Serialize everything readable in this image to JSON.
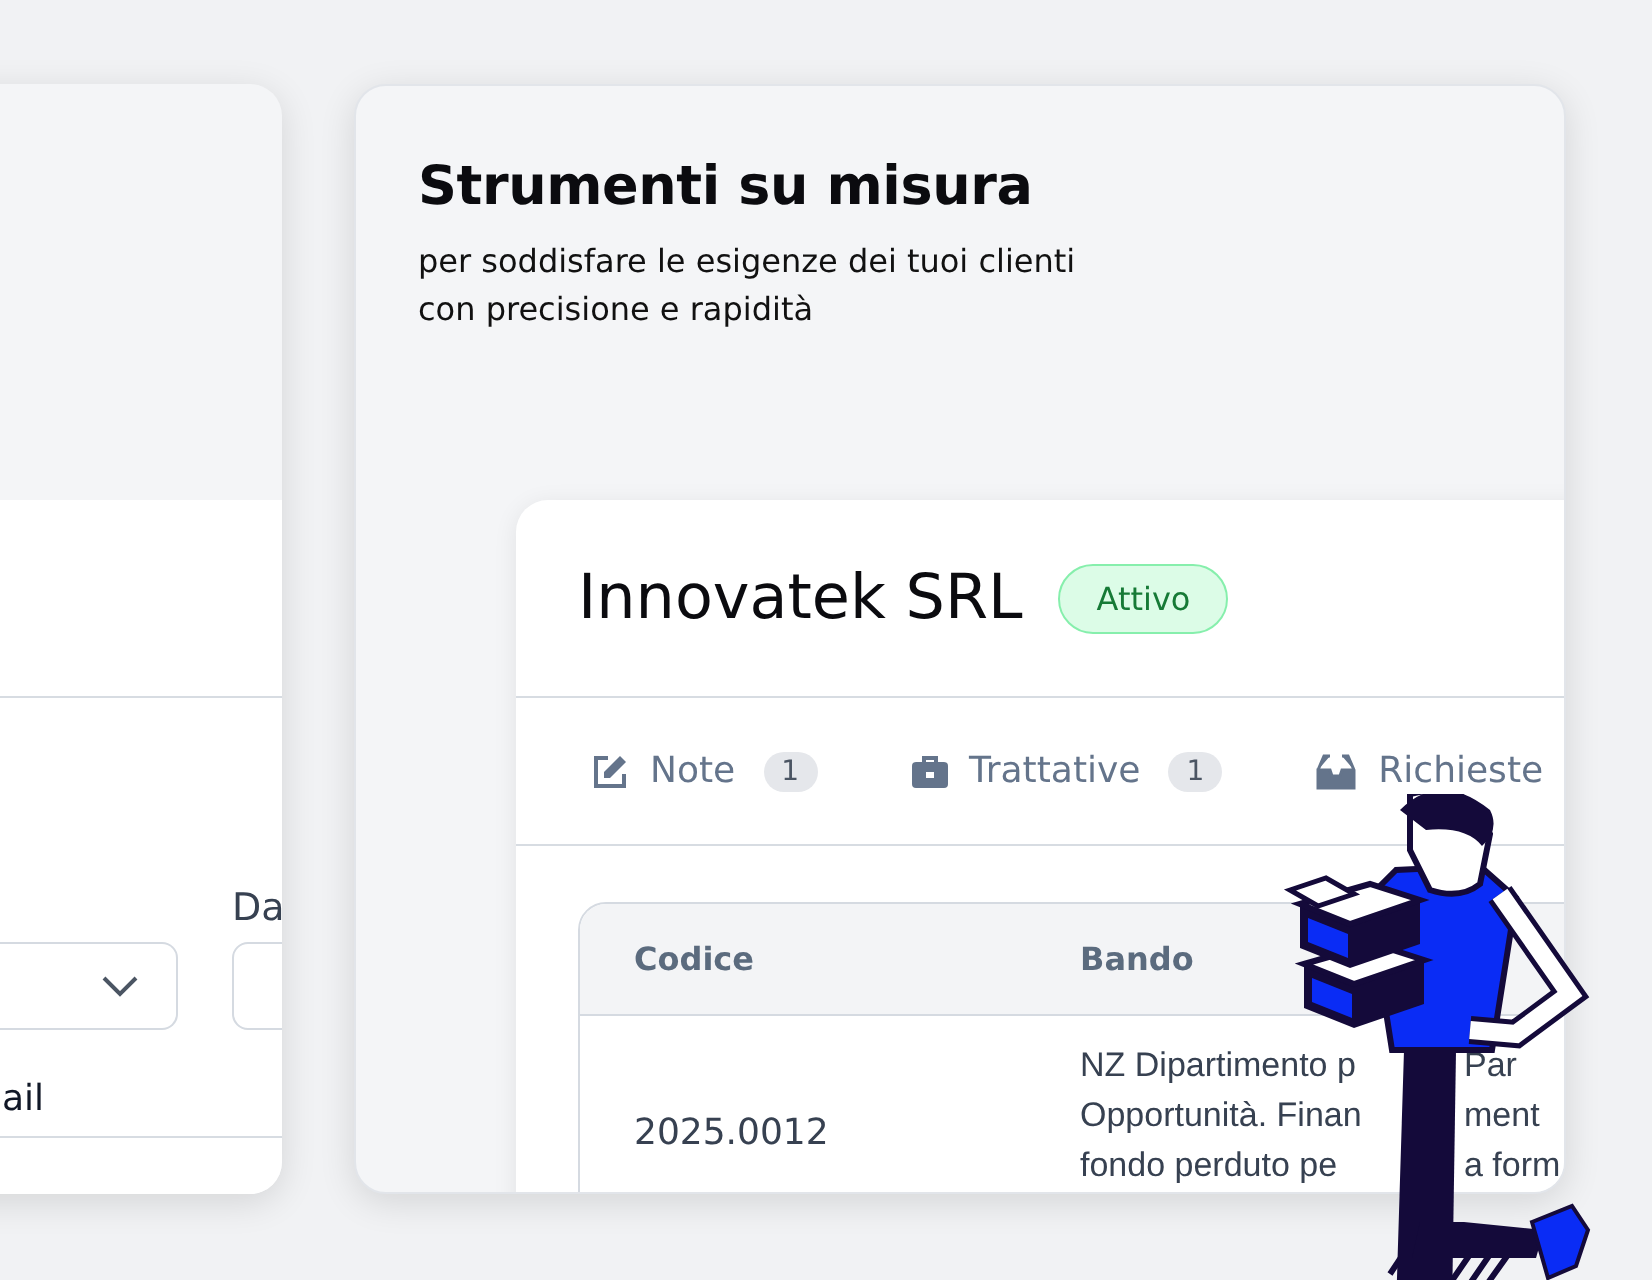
{
  "left_panel": {
    "field_label": "Da",
    "select": {
      "expanded": false
    },
    "footer_label": "ail"
  },
  "feature": {
    "title": "Strumenti su misura",
    "subtitle_lines": [
      "per soddisfare le esigenze dei tuoi clienti",
      "con precisione e rapidità"
    ]
  },
  "company": {
    "name": "Innovatek SRL",
    "status": "Attivo",
    "tabs": [
      {
        "kind": "note",
        "label": "Note",
        "count": "1"
      },
      {
        "kind": "deals",
        "label": "Trattative",
        "count": "1"
      },
      {
        "kind": "requests",
        "label": "Richieste"
      }
    ],
    "table": {
      "columns": [
        "Codice",
        "Bando"
      ],
      "rows": [
        {
          "code": "2025.0012",
          "bando_lines": [
            {
              "before": "NZ Dipartimento p",
              "after": "Par"
            },
            {
              "before": "Opportunità. Finan",
              "after": "ment"
            },
            {
              "before": "fondo perduto pe",
              "after": "a form"
            }
          ]
        }
      ]
    }
  }
}
